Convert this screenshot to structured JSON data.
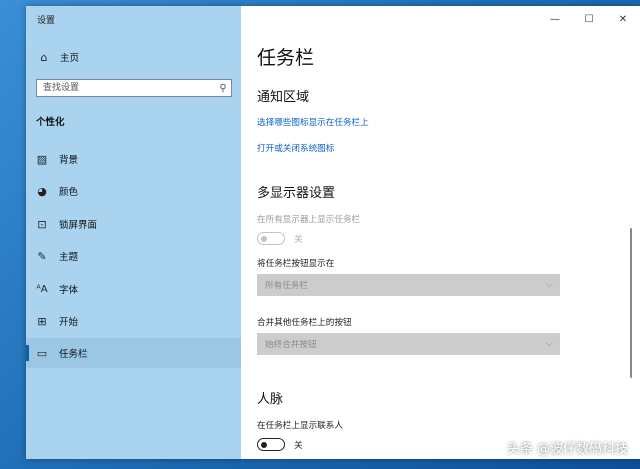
{
  "window": {
    "title": "设置",
    "controls": {
      "minimize": "—",
      "maximize": "☐",
      "close": "✕"
    }
  },
  "sidebar": {
    "home": {
      "icon": "home-icon",
      "label": "主页"
    },
    "search": {
      "placeholder": "查找设置",
      "icon": "search-icon"
    },
    "section_title": "个性化",
    "items": [
      {
        "icon": "image-icon",
        "label": "背景"
      },
      {
        "icon": "palette-icon",
        "label": "颜色"
      },
      {
        "icon": "lock-screen-icon",
        "label": "锁屏界面"
      },
      {
        "icon": "brush-icon",
        "label": "主题"
      },
      {
        "icon": "font-icon",
        "label": "字体"
      },
      {
        "icon": "start-icon",
        "label": "开始"
      },
      {
        "icon": "taskbar-icon",
        "label": "任务栏",
        "active": true
      }
    ]
  },
  "content": {
    "page_title": "任务栏",
    "notification_area": {
      "heading": "通知区域",
      "link1": "选择哪些图标显示在任务栏上",
      "link2": "打开或关闭系统图标"
    },
    "multi_display": {
      "heading": "多显示器设置",
      "show_all_label": "在所有显示器上显示任务栏",
      "show_all_state": "关",
      "show_buttons_label": "将任务栏按钮显示在",
      "show_buttons_value": "所有任务栏",
      "combine_label": "合并其他任务栏上的按钮",
      "combine_value": "始终合并按钮"
    },
    "people": {
      "heading": "人脉",
      "show_contacts_label": "在任务栏上显示联系人",
      "show_contacts_state": "关"
    }
  },
  "watermark": "头条 @波仔数码科技",
  "colors": {
    "sidebar_bg": "#a9d3ef",
    "active_item_bg": "#9bc6e4",
    "accent": "#0a5fa8",
    "link": "#0f63c4"
  }
}
